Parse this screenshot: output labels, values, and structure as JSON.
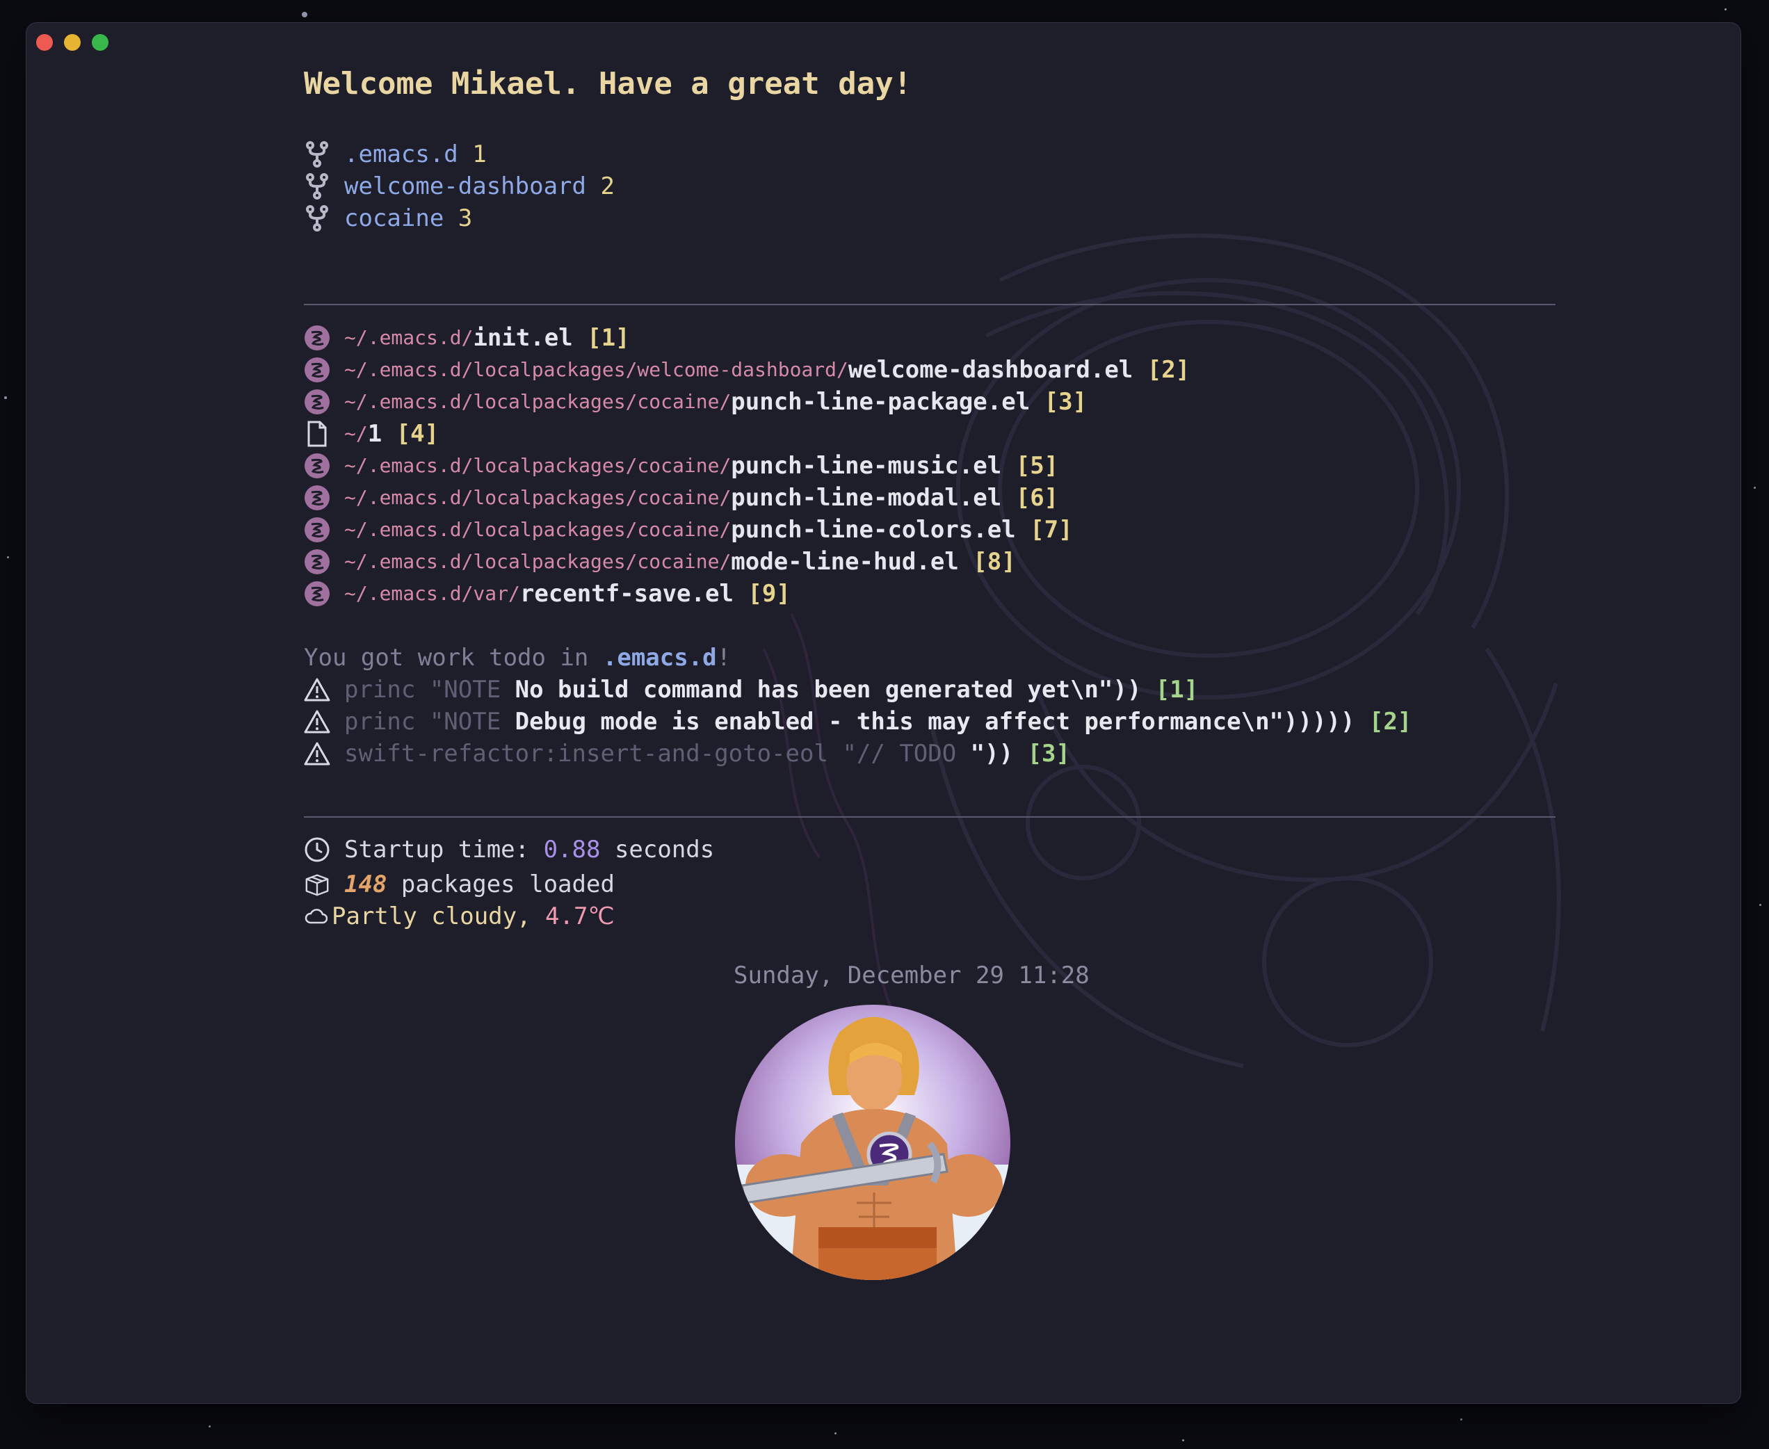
{
  "window": {
    "traffic_lights": [
      "close",
      "minimize",
      "zoom"
    ],
    "colors": {
      "close": "#ee5a52",
      "minimize": "#e6b332",
      "zoom": "#38b84a"
    }
  },
  "header": {
    "welcome": "Welcome Mikael. Have a great day!"
  },
  "projects": [
    {
      "name": ".emacs.d",
      "index": "1",
      "icon": "git-fork-icon"
    },
    {
      "name": "welcome-dashboard",
      "index": "2",
      "icon": "git-fork-icon"
    },
    {
      "name": "cocaine",
      "index": "3",
      "icon": "git-fork-icon"
    }
  ],
  "recent_files": [
    {
      "dir": "~/.emacs.d/",
      "file": "init.el",
      "index": "[1]",
      "icon": "emacs-icon"
    },
    {
      "dir": "~/.emacs.d/localpackages/welcome-dashboard/",
      "file": "welcome-dashboard.el",
      "index": "[2]",
      "icon": "emacs-icon"
    },
    {
      "dir": "~/.emacs.d/localpackages/cocaine/",
      "file": "punch-line-package.el",
      "index": "[3]",
      "icon": "emacs-icon"
    },
    {
      "dir": "~/",
      "file": "1",
      "index": "[4]",
      "icon": "file-icon"
    },
    {
      "dir": "~/.emacs.d/localpackages/cocaine/",
      "file": "punch-line-music.el",
      "index": "[5]",
      "icon": "emacs-icon"
    },
    {
      "dir": "~/.emacs.d/localpackages/cocaine/",
      "file": "punch-line-modal.el",
      "index": "[6]",
      "icon": "emacs-icon"
    },
    {
      "dir": "~/.emacs.d/localpackages/cocaine/",
      "file": "punch-line-colors.el",
      "index": "[7]",
      "icon": "emacs-icon"
    },
    {
      "dir": "~/.emacs.d/localpackages/cocaine/",
      "file": "mode-line-hud.el",
      "index": "[8]",
      "icon": "emacs-icon"
    },
    {
      "dir": "~/.emacs.d/var/",
      "file": "recentf-save.el",
      "index": "[9]",
      "icon": "emacs-icon"
    }
  ],
  "todos": {
    "intro_prefix": "You got work todo in ",
    "project": ".emacs.d",
    "intro_suffix": "!",
    "items": [
      {
        "prefix": "princ \"NOTE ",
        "text": "No build command has been generated yet\\n\"))",
        "index": "[1]",
        "icon": "warning-icon"
      },
      {
        "prefix": "princ \"NOTE ",
        "text": "Debug mode is enabled - this may affect performance\\n\")))))",
        "index": "[2]",
        "icon": "warning-icon"
      },
      {
        "prefix": "swift-refactor:insert-and-goto-eol \"// TODO ",
        "text": "\"))",
        "index": "[3]",
        "icon": "warning-icon"
      }
    ]
  },
  "stats": {
    "startup_label": "Startup time: ",
    "startup_value": "0.88",
    "startup_unit": " seconds",
    "packages_value": "148",
    "packages_label": " packages loaded",
    "weather_label": "Partly cloudy, ",
    "weather_temp": "4.7℃"
  },
  "footer": {
    "datetime": "Sunday, December 29 11:28"
  },
  "theme": {
    "background": "#1e1e2b",
    "heading": "#e9d6a2",
    "project": "#8fa9e6",
    "path": "#d68aa8",
    "emacs_icon": "#a0709e",
    "accent_purple": "#a990e8",
    "accent_orange": "#e5a56a"
  }
}
